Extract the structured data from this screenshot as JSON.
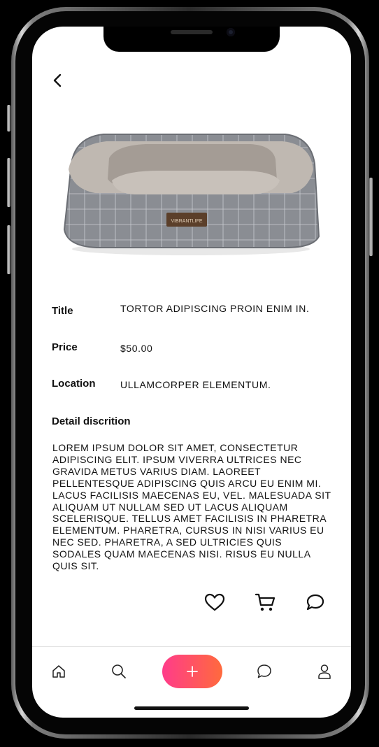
{
  "header": {
    "back_icon": "chevron-left-icon"
  },
  "product": {
    "image_alt": "grey plaid dog bed",
    "brand_tag": "VIBRANTLIFE",
    "fields": [
      {
        "label": "Title",
        "value": "TORTOR ADIPISCING PROIN ENIM IN."
      },
      {
        "label": "Price",
        "value": "$50.00"
      },
      {
        "label": "Location",
        "value": "ULLAMCORPER ELEMENTUM."
      }
    ],
    "detail_label": "Detail discrition",
    "detail_text": "LOREM IPSUM DOLOR SIT AMET, CONSECTETUR ADIPISCING ELIT. IPSUM VIVERRA ULTRICES NEC GRAVIDA METUS VARIUS DIAM. LAOREET PELLENTESQUE ADIPISCING QUIS ARCU EU ENIM MI. LACUS FACILISIS MAECENAS EU, VEL. MALESUADA SIT ALIQUAM UT NULLAM SED UT LACUS ALIQUAM SCELERISQUE. TELLUS AMET FACILISIS IN PHARETRA ELEMENTUM. PHARETRA, CURSUS IN NISI VARIUS EU NEC SED. PHARETRA, A SED ULTRICIES QUIS SODALES QUAM MAECENAS NISI. RISUS EU NULLA QUIS SIT."
  },
  "actions": [
    "heart-icon",
    "cart-icon",
    "chat-icon"
  ],
  "bottom_nav": {
    "items": [
      "home-icon",
      "search-icon",
      "plus-icon",
      "chat-icon",
      "user-icon"
    ],
    "add_button_gradient": [
      "#ff3c8a",
      "#ff6a3d"
    ]
  },
  "colors": {
    "text": "#111111",
    "screen_bg": "#ffffff"
  }
}
